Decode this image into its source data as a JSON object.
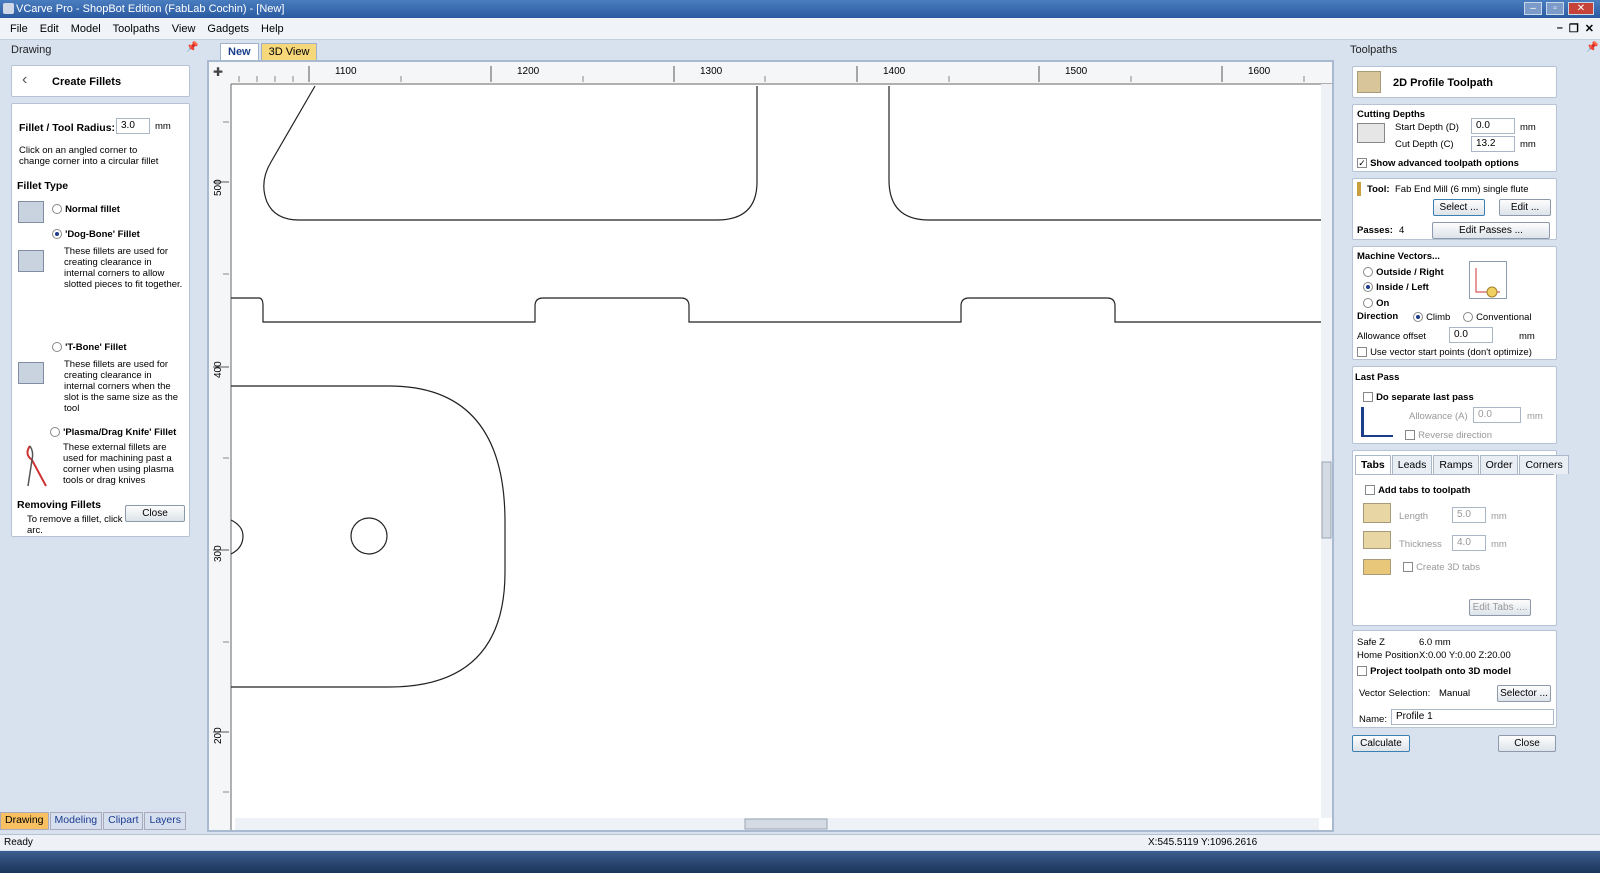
{
  "window": {
    "title": "VCarve Pro - ShopBot Edition (FabLab Cochin) - [New]"
  },
  "menu": [
    "File",
    "Edit",
    "Model",
    "Toolpaths",
    "View",
    "Gadgets",
    "Help"
  ],
  "left": {
    "panel_title": "Drawing",
    "header": "Create Fillets",
    "radius_label": "Fillet / Tool Radius:",
    "radius_value": "3.0",
    "radius_unit": "mm",
    "hint": "Click on an angled corner to change corner into a circular fillet",
    "type_heading": "Fillet Type",
    "options": [
      {
        "label": "Normal fillet",
        "desc": ""
      },
      {
        "label": "'Dog-Bone' Fillet",
        "desc": "These fillets are used for creating clearance in internal corners to allow slotted pieces to fit together."
      },
      {
        "label": "'T-Bone' Fillet",
        "desc": "These fillets are used for creating clearance in internal corners when the slot is the same size as the tool"
      },
      {
        "label": "'Plasma/Drag Knife' Fillet",
        "desc": "These external fillets are used for machining past a corner when using plasma tools or drag knives"
      }
    ],
    "removing_heading": "Removing Fillets",
    "removing_text": "To remove a fillet, click on the fillet arc.",
    "close": "Close",
    "bottom_tabs": [
      "Drawing",
      "Modeling",
      "Clipart",
      "Layers"
    ]
  },
  "doc_tabs": [
    "New",
    "3D View"
  ],
  "ruler": {
    "h": [
      "1100",
      "1200",
      "1300",
      "1400",
      "1500",
      "1600"
    ],
    "v": [
      "500",
      "400",
      "300",
      "200"
    ]
  },
  "right": {
    "panel_title": "Toolpaths",
    "header": "2D Profile Toolpath",
    "cutting_depths": "Cutting Depths",
    "start_depth_label": "Start Depth (D)",
    "start_depth": "0.0",
    "cut_depth_label": "Cut Depth (C)",
    "cut_depth": "13.2",
    "unit": "mm",
    "advanced": "Show advanced toolpath options",
    "tool_label": "Tool:",
    "tool_name": "Fab End Mill (6 mm) single flute",
    "select": "Select ...",
    "edit": "Edit ...",
    "passes_label": "Passes:",
    "passes": "4",
    "edit_passes": "Edit Passes ...",
    "machine_vectors": "Machine Vectors...",
    "mv_outside": "Outside / Right",
    "mv_inside": "Inside / Left",
    "mv_on": "On",
    "direction": "Direction",
    "climb": "Climb",
    "conventional": "Conventional",
    "allowance_label": "Allowance offset",
    "allowance": "0.0",
    "use_start": "Use vector start points (don't optimize)",
    "last_pass": "Last Pass",
    "separate_last": "Do separate last pass",
    "lp_allowance_label": "Allowance (A)",
    "lp_allowance": "0.0",
    "reverse": "Reverse direction",
    "tabs": [
      "Tabs",
      "Leads",
      "Ramps",
      "Order",
      "Corners"
    ],
    "add_tabs": "Add tabs to toolpath",
    "length_label": "Length",
    "length": "5.0",
    "thickness_label": "Thickness",
    "thickness": "4.0",
    "create3d": "Create 3D tabs",
    "edit_tabs": "Edit Tabs ....",
    "safe_z_label": "Safe Z",
    "safe_z": "6.0 mm",
    "home_label": "Home Position",
    "home": "X:0.00 Y:0.00 Z:20.00",
    "project": "Project toolpath onto 3D model",
    "vecsel_label": "Vector Selection:",
    "vecsel": "Manual",
    "selector": "Selector ...",
    "name_label": "Name:",
    "name": "Profile 1",
    "calculate": "Calculate",
    "close": "Close"
  },
  "status": {
    "left": "Ready",
    "coords": "X:545.5119 Y:1096.2616"
  }
}
